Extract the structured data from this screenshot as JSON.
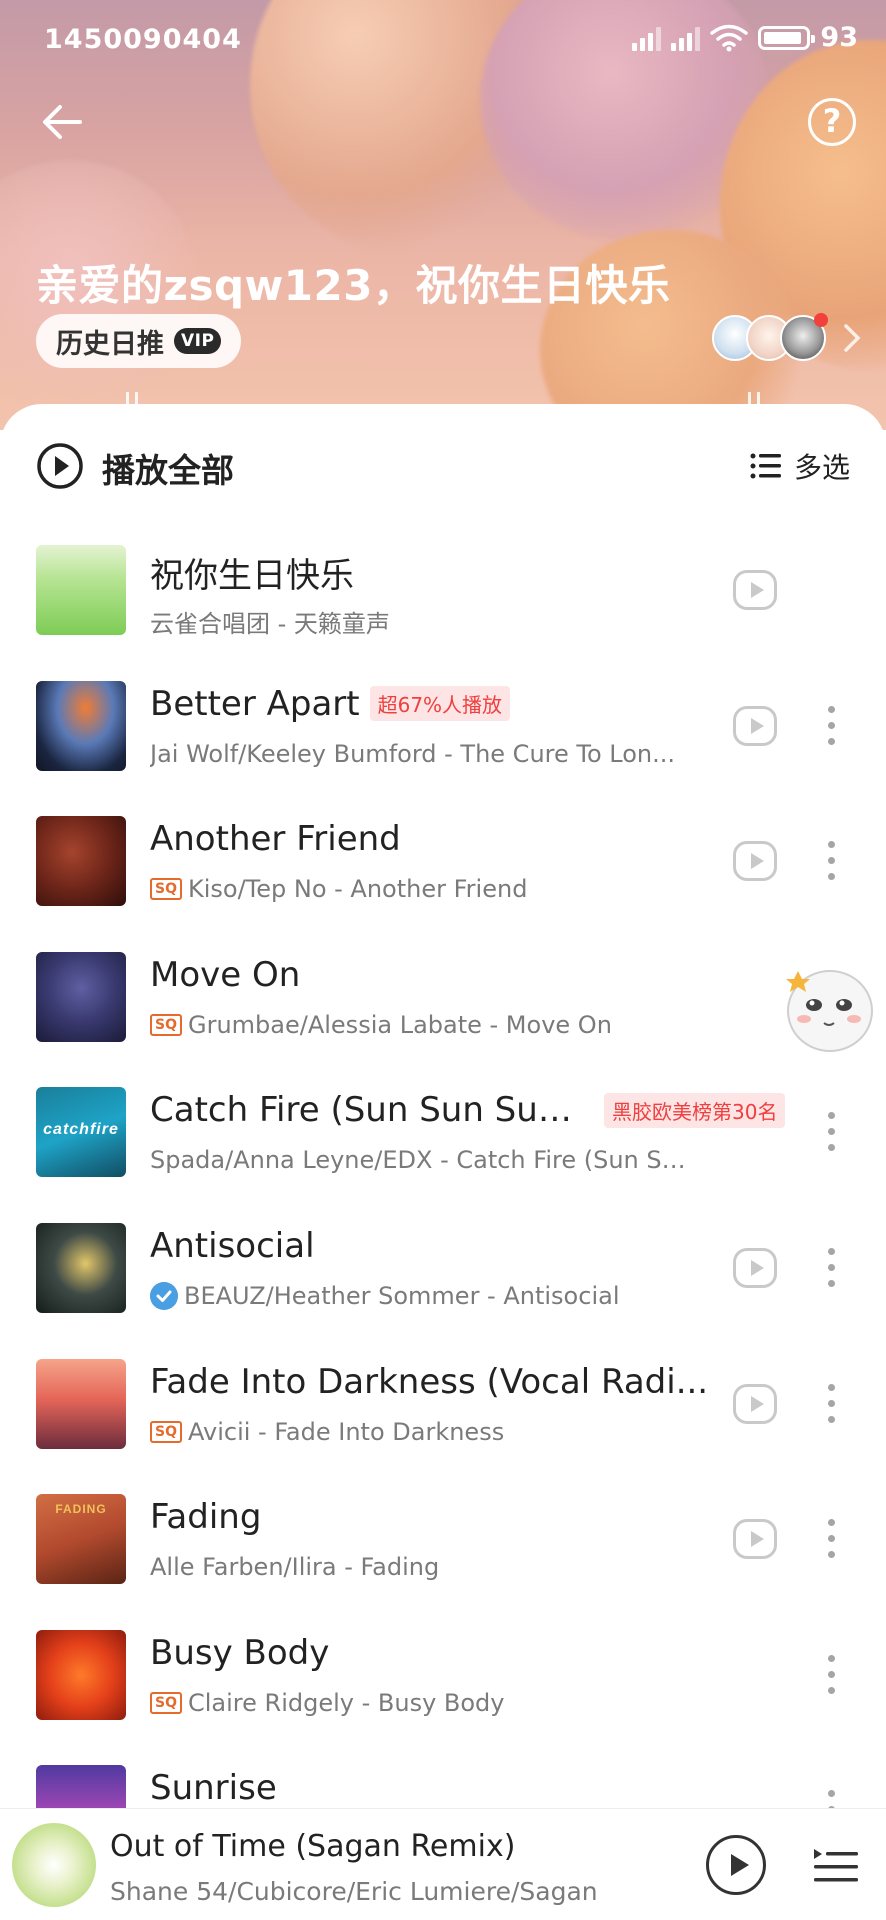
{
  "status_bar": {
    "time": "1450090404",
    "battery": "93"
  },
  "header": {
    "greeting": "亲爱的zsqw123，祝你生日快乐",
    "history_label": "历史日推",
    "vip_badge": "VIP"
  },
  "toolbar": {
    "play_all_label": "播放全部",
    "multi_select_label": "多选"
  },
  "songs": [
    {
      "title": "祝你生日快乐",
      "subtitle": "云雀合唱团 - 天籁童声",
      "tag": "",
      "quality": "",
      "verified": false,
      "has_mv": true,
      "has_more": false
    },
    {
      "title": "Better Apart",
      "subtitle": "Jai Wolf/Keeley Bumford - The Cure To Lon...",
      "tag": "超67%人播放",
      "quality": "",
      "verified": false,
      "has_mv": true,
      "has_more": true
    },
    {
      "title": "Another Friend",
      "subtitle": "Kiso/Tep No - Another Friend",
      "tag": "",
      "quality": "SQ",
      "verified": false,
      "has_mv": true,
      "has_more": true
    },
    {
      "title": "Move On",
      "subtitle": "Grumbae/Alessia Labate - Move On",
      "tag": "",
      "quality": "SQ",
      "verified": false,
      "has_mv": false,
      "has_more": true
    },
    {
      "title": "Catch Fire (Sun Sun Sun...",
      "subtitle": "Spada/Anna Leyne/EDX - Catch Fire (Sun Sun Sun)",
      "tag": "黑胶欧美榜第30名",
      "quality": "",
      "verified": false,
      "has_mv": false,
      "has_more": true
    },
    {
      "title": "Antisocial",
      "subtitle": "BEAUZ/Heather Sommer - Antisocial",
      "tag": "",
      "quality": "",
      "verified": true,
      "has_mv": true,
      "has_more": true
    },
    {
      "title": "Fade Into Darkness (Vocal Radi...",
      "subtitle": "Avicii - Fade Into Darkness",
      "tag": "",
      "quality": "SQ",
      "verified": false,
      "has_mv": true,
      "has_more": true
    },
    {
      "title": "Fading",
      "subtitle": "Alle Farben/Ilira - Fading",
      "tag": "",
      "quality": "",
      "verified": false,
      "has_mv": true,
      "has_more": true
    },
    {
      "title": "Busy Body",
      "subtitle": "Claire Ridgely - Busy Body",
      "tag": "",
      "quality": "SQ",
      "verified": false,
      "has_mv": false,
      "has_more": true
    },
    {
      "title": "Sunrise",
      "subtitle": "",
      "tag": "",
      "quality": "",
      "verified": false,
      "has_mv": false,
      "has_more": true
    }
  ],
  "cover_texts": {
    "catch_fire": "catchfire",
    "fading": "FADING"
  },
  "now_playing": {
    "title": "Out of Time (Sagan Remix)",
    "artists": "Shane 54/Cubicore/Eric Lumiere/Sagan"
  },
  "colors": {
    "accent_red": "#ef3f3f",
    "sq_orange": "#e46b2c",
    "verified_blue": "#4a9fe2"
  },
  "icons": {
    "back": "back-arrow-icon",
    "help": "help-icon",
    "play_all": "play-circle-icon",
    "multi_select": "list-icon",
    "mv": "mv-play-icon",
    "more": "more-vertical-icon",
    "playlist": "playlist-icon"
  }
}
